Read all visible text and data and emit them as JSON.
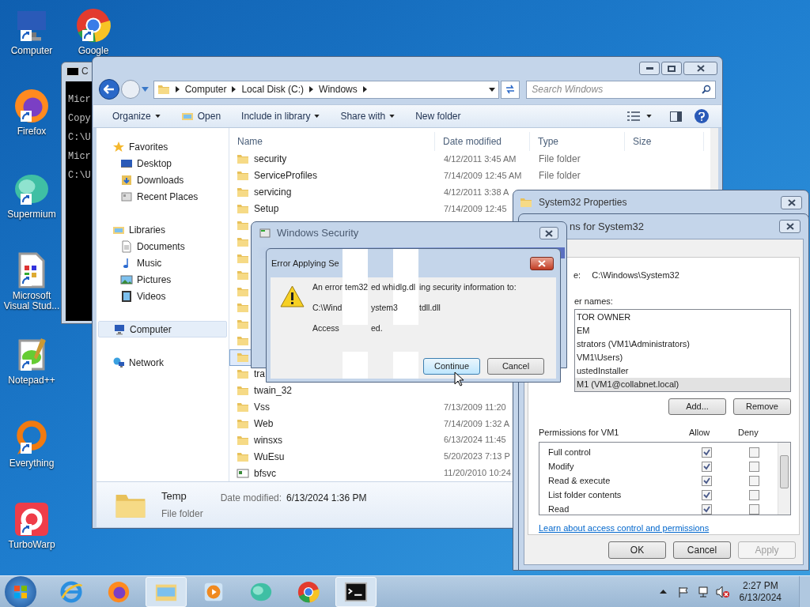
{
  "desktop_icons": [
    {
      "label": "Computer",
      "kind": "computer"
    },
    {
      "label": "Google",
      "kind": "chrome"
    },
    {
      "label": "Firefox",
      "kind": "firefox"
    },
    {
      "label": "Supermium",
      "kind": "supermium"
    },
    {
      "label": "Microsoft Visual Stud...",
      "kind": "document"
    },
    {
      "label": "Notepad++",
      "kind": "notepad"
    },
    {
      "label": "Everything",
      "kind": "everything"
    },
    {
      "label": "TurboWarp",
      "kind": "turbowarp"
    }
  ],
  "cmd_window": {
    "title": "C",
    "lines": [
      "Micr",
      "Copy",
      "C:\\U",
      "Micr",
      "C:\\U"
    ]
  },
  "explorer": {
    "address": [
      "Computer",
      "Local Disk (C:)",
      "Windows"
    ],
    "search": {
      "placeholder": "Search Windows"
    },
    "toolbar": [
      {
        "label": "Organize",
        "kind": "menu"
      },
      {
        "label": "Open",
        "kind": "open"
      },
      {
        "label": "Include in library",
        "kind": "menu"
      },
      {
        "label": "Share with",
        "kind": "menu"
      },
      {
        "label": "New folder",
        "kind": "plain"
      }
    ],
    "nav": [
      {
        "label": "Favorites",
        "kind": "star",
        "selected": false,
        "children": [
          {
            "label": "Desktop",
            "kind": "desktop",
            "selected": false
          },
          {
            "label": "Downloads",
            "kind": "downloads",
            "selected": false
          },
          {
            "label": "Recent Places",
            "kind": "recent",
            "selected": false
          }
        ]
      },
      {
        "label": "Libraries",
        "kind": "libraries",
        "selected": false,
        "children": [
          {
            "label": "Documents",
            "kind": "documents",
            "selected": false
          },
          {
            "label": "Music",
            "kind": "music",
            "selected": false
          },
          {
            "label": "Pictures",
            "kind": "pictures",
            "selected": false
          },
          {
            "label": "Videos",
            "kind": "videos",
            "selected": false
          }
        ]
      },
      {
        "label": "Computer",
        "kind": "computer",
        "selected": true
      },
      {
        "label": "Network",
        "kind": "network",
        "selected": false
      }
    ],
    "columns": [
      "Name",
      "Date modified",
      "Type",
      "Size"
    ],
    "rows": [
      {
        "kind": "folder",
        "name": "security",
        "date": "4/12/2011 3:45 AM",
        "type": "File folder",
        "selected": false
      },
      {
        "kind": "folder",
        "name": "ServiceProfiles",
        "date": "7/14/2009 12:45 AM",
        "type": "File folder",
        "selected": false
      },
      {
        "kind": "folder",
        "name": "servicing",
        "date": "4/12/2011 3:38 A",
        "selected": false
      },
      {
        "kind": "folder",
        "name": "Setup",
        "date": "7/14/2009 12:45",
        "selected": false
      },
      {
        "kind": "folder",
        "selected": false
      },
      {
        "kind": "folder",
        "selected": false
      },
      {
        "kind": "folder",
        "selected": false
      },
      {
        "kind": "folder",
        "selected": false
      },
      {
        "kind": "folder",
        "selected": false
      },
      {
        "kind": "folder",
        "selected": false
      },
      {
        "kind": "folder",
        "selected": false
      },
      {
        "kind": "folder",
        "selected": false
      },
      {
        "kind": "folder",
        "selected": true
      },
      {
        "kind": "folder",
        "name": "tra",
        "selected": false
      },
      {
        "kind": "folder",
        "name": "twain_32",
        "selected": false
      },
      {
        "kind": "folder",
        "name": "Vss",
        "date": "7/13/2009 11:20",
        "selected": false
      },
      {
        "kind": "folder",
        "name": "Web",
        "date": "7/14/2009 1:32 A",
        "selected": false
      },
      {
        "kind": "folder",
        "name": "winsxs",
        "date": "6/13/2024 11:45",
        "selected": false
      },
      {
        "kind": "folder",
        "name": "WuEsu",
        "date": "5/20/2023 7:13 P",
        "selected": false
      },
      {
        "kind": "file",
        "name": "bfsvc",
        "date": "11/20/2010 10:24",
        "selected": false
      }
    ],
    "details": {
      "name": "Temp",
      "type": "File folder",
      "date_label": "Date modified:",
      "date": "6/13/2024 1:36 PM"
    }
  },
  "properties_window": {
    "title": "System32 Properties"
  },
  "permissions_dialog": {
    "title": "ns for System32",
    "object_label": "e:",
    "object_value": "C:\\Windows\\System32",
    "groups_label": "er names:",
    "groups": [
      {
        "name": "TOR OWNER",
        "selected": false
      },
      {
        "name": "EM",
        "selected": false
      },
      {
        "name": "strators (VM1\\Administrators)",
        "selected": false
      },
      {
        "name": "VM1\\Users)",
        "selected": false
      },
      {
        "name": "ustedInstaller",
        "selected": false
      },
      {
        "name": "M1 (VM1@collabnet.local)",
        "selected": true
      }
    ],
    "group_buttons": [
      "Add...",
      "Remove"
    ],
    "perm_title": "Permissions for VM1",
    "allow_label": "Allow",
    "deny_label": "Deny",
    "perms": [
      {
        "name": "Full control",
        "allow": true,
        "deny": false
      },
      {
        "name": "Modify",
        "allow": true,
        "deny": false
      },
      {
        "name": "Read & execute",
        "allow": true,
        "deny": false
      },
      {
        "name": "List folder contents",
        "allow": true,
        "deny": false
      },
      {
        "name": "Read",
        "allow": true,
        "deny": false
      }
    ],
    "link": "Learn about access control and permissions",
    "buttons": [
      {
        "label": "OK",
        "disabled": false
      },
      {
        "label": "Cancel",
        "disabled": false
      },
      {
        "label": "Apply",
        "disabled": true
      }
    ]
  },
  "security_dialog": {
    "title": "Windows Security"
  },
  "error_dialog": {
    "title": "Error Applying Se",
    "lines": [
      [
        "An error",
        "tem32",
        "ed whi",
        "dlg.dl",
        "ing security information to:"
      ],
      [
        "C:\\Wind",
        "ystem3",
        "tdll.dll"
      ],
      [
        "Access",
        "ed."
      ]
    ],
    "buttons": [
      {
        "label": "Continue",
        "default": true
      },
      {
        "label": "Cancel",
        "default": false
      }
    ]
  },
  "taskbar": {
    "apps": [
      {
        "kind": "ie",
        "active": false
      },
      {
        "kind": "firefox",
        "active": false
      },
      {
        "kind": "explorer",
        "active": true
      },
      {
        "kind": "media",
        "active": false
      },
      {
        "kind": "supermium",
        "active": false
      },
      {
        "kind": "chrome",
        "active": false
      },
      {
        "kind": "cmd",
        "active": true
      }
    ],
    "time": "2:27 PM",
    "date": "6/13/2024"
  }
}
